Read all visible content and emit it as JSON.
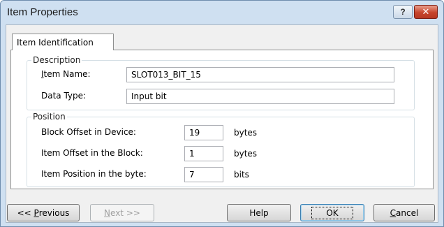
{
  "window": {
    "title": "Item Properties",
    "help_symbol": "?",
    "close_symbol": "✕"
  },
  "tab": {
    "label": "Item Identification"
  },
  "description": {
    "group_title": "Description",
    "item_name_label_accel": "I",
    "item_name_label_rest": "tem Name:",
    "item_name_value": "SLOT013_BIT_15",
    "data_type_label": "Data Type:",
    "data_type_value": "Input bit"
  },
  "position": {
    "group_title": "Position",
    "block_offset_label": "Block Offset in Device:",
    "block_offset_value": "19",
    "block_offset_unit": "bytes",
    "item_offset_label": "Item Offset in the Block:",
    "item_offset_value": "1",
    "item_offset_unit": "bytes",
    "item_position_label": "Item Position in the byte:",
    "item_position_value": "7",
    "item_position_unit": "bits"
  },
  "buttons": {
    "previous_prefix": "<< ",
    "previous_accel": "P",
    "previous_rest": "revious",
    "next_accel": "N",
    "next_rest": "ext >>",
    "help": "Help",
    "ok": "OK",
    "cancel_accel": "C",
    "cancel_rest": "ancel"
  }
}
